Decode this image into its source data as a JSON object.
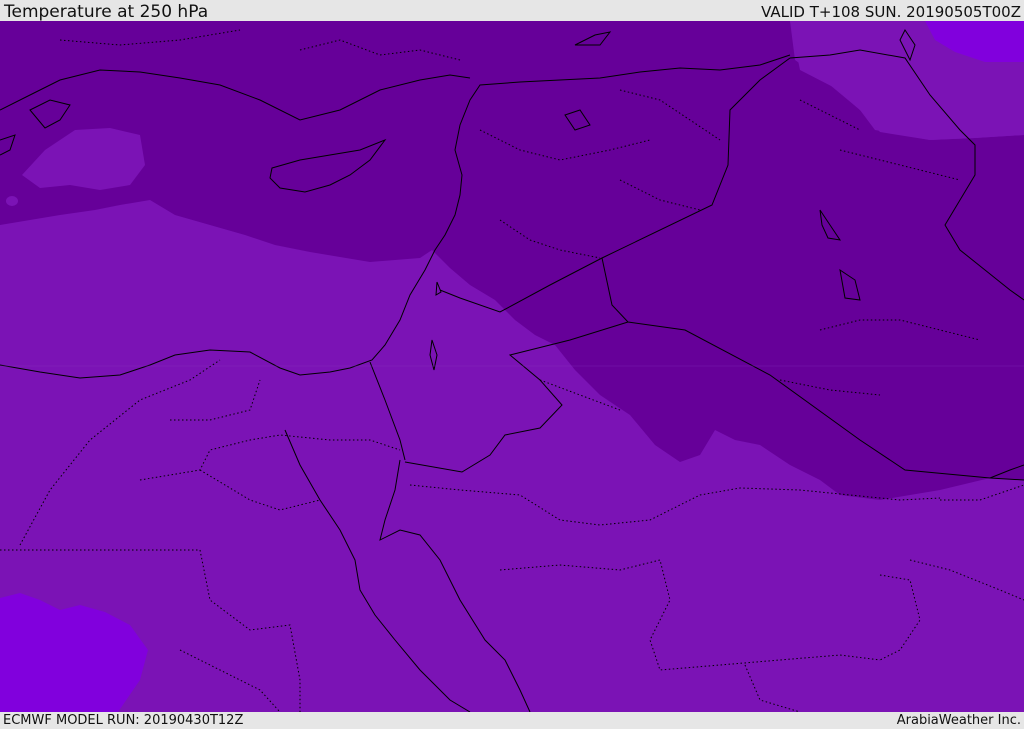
{
  "header": {
    "title": "Temperature at 250 hPa",
    "valid_time": "VALID T+108 SUN. 20190505T00Z"
  },
  "footer": {
    "model_run": "ECMWF MODEL RUN: 20190430T12Z",
    "credit": "ArabiaWeather Inc."
  },
  "map": {
    "fill_colors": {
      "base": "#7b13b5",
      "cold": "#660099",
      "warm": "#8100dd"
    },
    "boundary_colors": {
      "coastline": "#000000",
      "border": "#000000"
    }
  }
}
